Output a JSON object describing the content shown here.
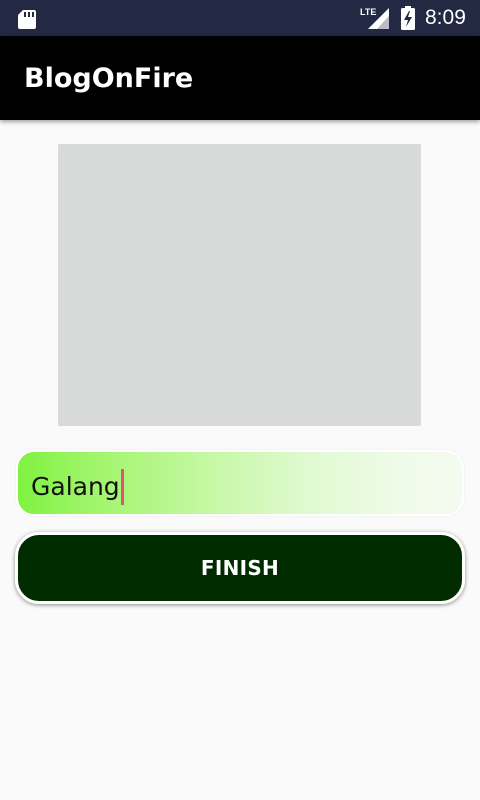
{
  "status_bar": {
    "time": "8:09",
    "network_label": "LTE",
    "icons": [
      "sd-card-icon",
      "lte-signal-icon",
      "battery-charging-icon"
    ]
  },
  "app_bar": {
    "title": "BlogOnFire"
  },
  "main": {
    "image_placeholder_color": "#d8d9d9",
    "name_input": {
      "value": "Galang",
      "gradient_colors": [
        "#7ff240",
        "#f4fbf0"
      ]
    },
    "finish_button": {
      "label": "FINISH",
      "background": "#002c00"
    }
  },
  "colors": {
    "status_bar": "#232843",
    "app_bar": "#000000",
    "background": "#fafafa",
    "cursor": "#d9577a"
  }
}
